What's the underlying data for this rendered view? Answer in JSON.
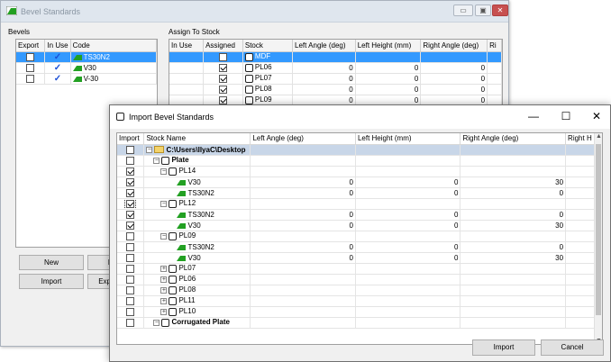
{
  "back_window": {
    "title": "Bevel Standards",
    "controls": {
      "minimize": "▭",
      "restore": "▣",
      "close": "✕"
    },
    "bevels": {
      "label": "Bevels",
      "columns": [
        "Export",
        "In Use",
        "Code"
      ],
      "rows": [
        {
          "export": false,
          "in_use": true,
          "code": "TS30N2",
          "selected": true
        },
        {
          "export": false,
          "in_use": true,
          "code": "V30",
          "selected": false
        },
        {
          "export": false,
          "in_use": true,
          "code": "V-30",
          "selected": false
        }
      ]
    },
    "assign": {
      "label": "Assign To Stock",
      "columns": [
        "In Use",
        "Assigned",
        "Stock",
        "Left Angle (deg)",
        "Left Height (mm)",
        "Right Angle (deg)",
        "Ri"
      ],
      "rows": [
        {
          "in_use": "",
          "assigned": false,
          "stock": "MDF",
          "left_angle": "",
          "left_height": "",
          "right_angle": "",
          "selected": true
        },
        {
          "in_use": "",
          "assigned": true,
          "stock": "PL06",
          "left_angle": "0",
          "left_height": "0",
          "right_angle": "0",
          "selected": false
        },
        {
          "in_use": "",
          "assigned": true,
          "stock": "PL07",
          "left_angle": "0",
          "left_height": "0",
          "right_angle": "0",
          "selected": false
        },
        {
          "in_use": "",
          "assigned": true,
          "stock": "PL08",
          "left_angle": "0",
          "left_height": "0",
          "right_angle": "0",
          "selected": false
        },
        {
          "in_use": "",
          "assigned": true,
          "stock": "PL09",
          "left_angle": "0",
          "left_height": "0",
          "right_angle": "0",
          "selected": false
        }
      ]
    },
    "buttons": {
      "new": "New",
      "import": "Import",
      "export_partial": "Exp",
      "hidden_partial": "I"
    }
  },
  "front_window": {
    "title": "Import Bevel Standards",
    "controls": {
      "minimize": "—",
      "maximize": "☐",
      "close": "✕"
    },
    "columns": [
      "Import",
      "Stock Name",
      "Left Angle (deg)",
      "Left Height (mm)",
      "Right Angle (deg)",
      "Right H"
    ],
    "rows": [
      {
        "import": false,
        "level": 0,
        "expander": "−",
        "icon": "folder",
        "name": "C:\\Users\\IlyaC\\Desktop",
        "bold": true,
        "la": "",
        "lh": "",
        "ra": "",
        "selected": true
      },
      {
        "import": false,
        "level": 1,
        "expander": "−",
        "icon": "stock",
        "name": "Plate",
        "bold": true,
        "la": "",
        "lh": "",
        "ra": "",
        "selected": false
      },
      {
        "import": true,
        "level": 2,
        "expander": "−",
        "icon": "stock",
        "name": "PL14",
        "bold": false,
        "la": "",
        "lh": "",
        "ra": "",
        "selected": false
      },
      {
        "import": true,
        "level": 3,
        "expander": "",
        "icon": "bevel",
        "name": "V30",
        "bold": false,
        "la": "0",
        "lh": "0",
        "ra": "30",
        "selected": false
      },
      {
        "import": true,
        "level": 3,
        "expander": "",
        "icon": "bevel",
        "name": "TS30N2",
        "bold": false,
        "la": "0",
        "lh": "0",
        "ra": "0",
        "selected": false
      },
      {
        "import": true,
        "level": 2,
        "expander": "−",
        "icon": "stock",
        "name": "PL12",
        "bold": false,
        "la": "",
        "lh": "",
        "ra": "",
        "selected": false,
        "focus": true
      },
      {
        "import": true,
        "level": 3,
        "expander": "",
        "icon": "bevel",
        "name": "TS30N2",
        "bold": false,
        "la": "0",
        "lh": "0",
        "ra": "0",
        "selected": false
      },
      {
        "import": true,
        "level": 3,
        "expander": "",
        "icon": "bevel",
        "name": "V30",
        "bold": false,
        "la": "0",
        "lh": "0",
        "ra": "30",
        "selected": false
      },
      {
        "import": false,
        "level": 2,
        "expander": "−",
        "icon": "stock",
        "name": "PL09",
        "bold": false,
        "la": "",
        "lh": "",
        "ra": "",
        "selected": false
      },
      {
        "import": false,
        "level": 3,
        "expander": "",
        "icon": "bevel",
        "name": "TS30N2",
        "bold": false,
        "la": "0",
        "lh": "0",
        "ra": "0",
        "selected": false
      },
      {
        "import": false,
        "level": 3,
        "expander": "",
        "icon": "bevel",
        "name": "V30",
        "bold": false,
        "la": "0",
        "lh": "0",
        "ra": "30",
        "selected": false
      },
      {
        "import": false,
        "level": 2,
        "expander": "+",
        "icon": "stock",
        "name": "PL07",
        "bold": false,
        "la": "",
        "lh": "",
        "ra": "",
        "selected": false
      },
      {
        "import": false,
        "level": 2,
        "expander": "+",
        "icon": "stock",
        "name": "PL06",
        "bold": false,
        "la": "",
        "lh": "",
        "ra": "",
        "selected": false
      },
      {
        "import": false,
        "level": 2,
        "expander": "+",
        "icon": "stock",
        "name": "PL08",
        "bold": false,
        "la": "",
        "lh": "",
        "ra": "",
        "selected": false
      },
      {
        "import": false,
        "level": 2,
        "expander": "+",
        "icon": "stock",
        "name": "PL11",
        "bold": false,
        "la": "",
        "lh": "",
        "ra": "",
        "selected": false
      },
      {
        "import": false,
        "level": 2,
        "expander": "+",
        "icon": "stock",
        "name": "PL10",
        "bold": false,
        "la": "",
        "lh": "",
        "ra": "",
        "selected": false
      },
      {
        "import": false,
        "level": 1,
        "expander": "−",
        "icon": "stock",
        "name": "Corrugated Plate",
        "bold": true,
        "la": "",
        "lh": "",
        "ra": "",
        "selected": false
      }
    ],
    "buttons": {
      "import": "Import",
      "cancel": "Cancel"
    }
  },
  "colors": {
    "selection": "#3399ff",
    "tree_selection": "#c8d6e8",
    "check": "#1b4fd6",
    "bevel_green": "#22a022"
  }
}
